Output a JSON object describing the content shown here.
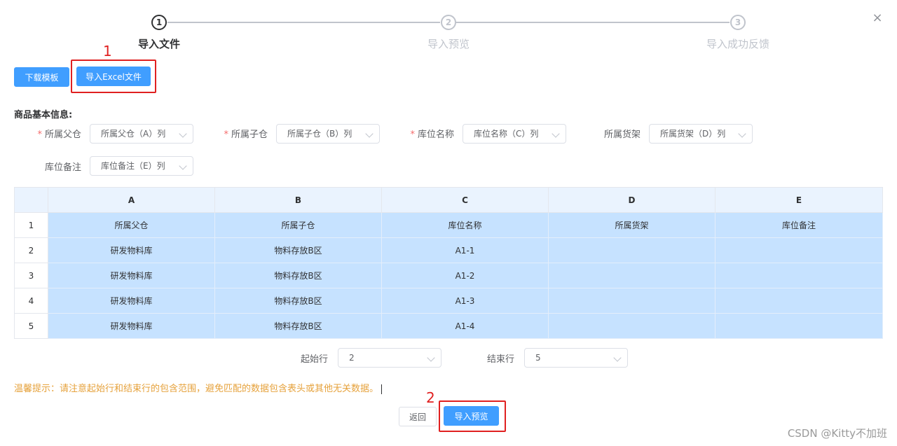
{
  "steps": [
    {
      "number": "1",
      "title": "导入文件",
      "state": "active"
    },
    {
      "number": "2",
      "title": "导入预览",
      "state": "pending"
    },
    {
      "number": "3",
      "title": "导入成功反馈",
      "state": "pending"
    }
  ],
  "close_icon": "×",
  "toolbar": {
    "download_template": "下载模板",
    "import_excel": "导入Excel文件"
  },
  "annotations": {
    "first": "1",
    "second": "2"
  },
  "section_title": "商品基本信息:",
  "mapping": [
    {
      "label": "所属父仓",
      "required": true,
      "value": "所属父仓（A）列"
    },
    {
      "label": "所属子仓",
      "required": true,
      "value": "所属子仓（B）列"
    },
    {
      "label": "库位名称",
      "required": true,
      "value": "库位名称（C）列"
    },
    {
      "label": "所属货架",
      "required": false,
      "value": "所属货架（D）列"
    },
    {
      "label": "库位备注",
      "required": false,
      "value": "库位备注（E）列"
    }
  ],
  "required_mark": "*",
  "table": {
    "columns": [
      "A",
      "B",
      "C",
      "D",
      "E"
    ],
    "rows": [
      {
        "num": "1",
        "cells": [
          "所属父仓",
          "所属子仓",
          "库位名称",
          "所属货架",
          "库位备注"
        ]
      },
      {
        "num": "2",
        "cells": [
          "研发物料库",
          "物料存放B区",
          "A1-1",
          "",
          ""
        ]
      },
      {
        "num": "3",
        "cells": [
          "研发物料库",
          "物料存放B区",
          "A1-2",
          "",
          ""
        ]
      },
      {
        "num": "4",
        "cells": [
          "研发物料库",
          "物料存放B区",
          "A1-3",
          "",
          ""
        ]
      },
      {
        "num": "5",
        "cells": [
          "研发物料库",
          "物料存放B区",
          "A1-4",
          "",
          ""
        ]
      }
    ]
  },
  "range": {
    "start_label": "起始行",
    "start_value": "2",
    "end_label": "结束行",
    "end_value": "5"
  },
  "tip": "温馨提示：请注意起始行和结束行的包含范围，避免匹配的数据包含表头或其他无关数据。",
  "footer": {
    "back": "返回",
    "preview": "导入预览"
  },
  "watermark": "CSDN @Kitty不加班",
  "colors": {
    "primary": "#409eff",
    "annotation": "#e02020",
    "tip": "#e6a23c",
    "selected_cell": "#c6e2ff"
  }
}
